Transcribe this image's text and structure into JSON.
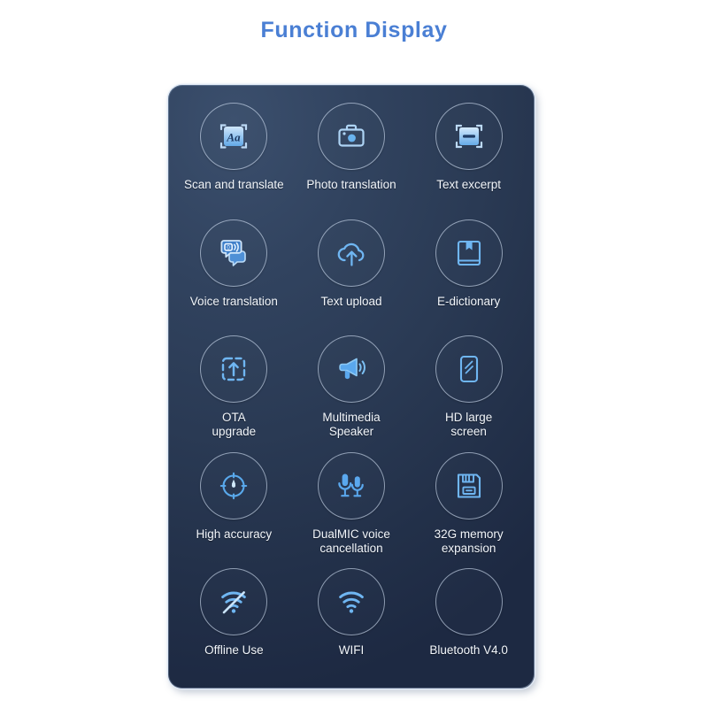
{
  "page": {
    "title": "Function Display",
    "title_color": "#4a7fd4",
    "background_color": "#ffffff"
  },
  "panel": {
    "name": "function-panel",
    "background_top_color": "#3b4f6d",
    "background_bottom_color": "#1d2942",
    "border_color": "#e1eaf6",
    "label_color": "#f2f6fb",
    "icon_color": "#7fc1f5",
    "circle_border_color": "#d0dff2"
  },
  "functions": [
    {
      "label": "Scan and translate",
      "icon": "scan-text-icon"
    },
    {
      "label": "Photo translation",
      "icon": "camera-icon"
    },
    {
      "label": "Text excerpt",
      "icon": "text-excerpt-icon"
    },
    {
      "label": "Voice translation",
      "icon": "voice-chat-icon"
    },
    {
      "label": "Text upload",
      "icon": "cloud-upload-icon"
    },
    {
      "label": "E-dictionary",
      "icon": "book-bookmark-icon"
    },
    {
      "label": "OTA\nupgrade",
      "icon": "ota-upgrade-icon"
    },
    {
      "label": "Multimedia\nSpeaker",
      "icon": "megaphone-icon"
    },
    {
      "label": "HD large\nscreen",
      "icon": "screen-icon"
    },
    {
      "label": "High accuracy",
      "icon": "crosshair-icon"
    },
    {
      "label": "DualMIC voice\ncancellation",
      "icon": "dual-microphone-icon"
    },
    {
      "label": "32G memory\nexpansion",
      "icon": "memory-card-icon"
    },
    {
      "label": "Offline Use",
      "icon": "wifi-off-icon"
    },
    {
      "label": "WIFI",
      "icon": "wifi-icon"
    },
    {
      "label": "Bluetooth V4.0",
      "icon": "blank-icon"
    }
  ]
}
